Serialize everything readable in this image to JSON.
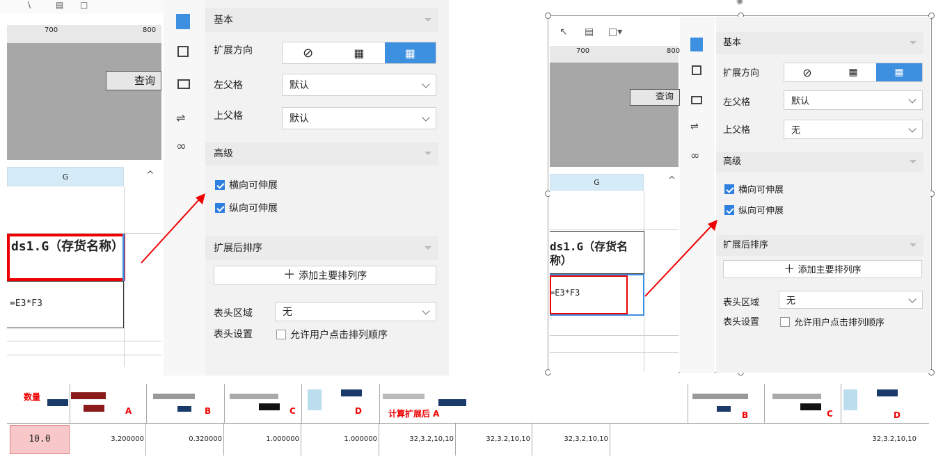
{
  "left": {
    "ruler_marks": [
      "700",
      "800"
    ],
    "query_button": "查询",
    "column_header": "G",
    "cell_dsg": "ds1.G（存货名称）",
    "cell_formula": "=E3*F3",
    "scroll_up": "^"
  },
  "left_panel": {
    "basic": "基本",
    "expand_direction": "扩展方向",
    "left_parent": "左父格",
    "left_parent_value": "默认",
    "top_parent": "上父格",
    "top_parent_value": "默认",
    "advanced": "高级",
    "horizontal_expand": "横向可伸展",
    "vertical_expand": "纵向可伸展",
    "sort_after_expand": "扩展后排序",
    "add_sort": "添加主要排列序",
    "header_area": "表头区域",
    "header_area_value": "无",
    "header_settings": "表头设置",
    "allow_click_sort": "允许用户点击排列顺序"
  },
  "right": {
    "ruler_marks": [
      "700",
      "800"
    ],
    "query_button": "查询",
    "column_header": "G",
    "cell_dsg": "ds1.G（存货名称）",
    "cell_formula": "=E3*F3"
  },
  "right_panel": {
    "basic": "基本",
    "expand_direction": "扩展方向",
    "left_parent": "左父格",
    "left_parent_value": "默认",
    "top_parent": "上父格",
    "top_parent_value": "无",
    "advanced": "高级",
    "horizontal_expand": "横向可伸展",
    "vertical_expand": "纵向可伸展",
    "sort_after_expand": "扩展后排序",
    "add_sort": "添加主要排列序",
    "header_area": "表头区域",
    "header_area_value": "无",
    "header_settings": "表头设置",
    "allow_click_sort": "允许用户点击排列顺序"
  },
  "bottom_table": {
    "header_labels": [
      "数量",
      "A",
      "B",
      "C",
      "D",
      "计算扩展后 A",
      "B",
      "C",
      "D"
    ],
    "first_cell": "10.0",
    "values": [
      "3.200000",
      "0.320000",
      "1.000000",
      "1.000000",
      "32,3.2,10,10",
      "32,3.2,10,10",
      "32,3.2,10,10",
      "32,3.2,10,10"
    ]
  },
  "colors": {
    "accent_blue": "#3d8fe0",
    "red_highlight": "#e00000",
    "panel_bg": "#f2f2f2",
    "section_header_bg": "#ebebeb",
    "column_header_bg": "#d5ebf8",
    "first_cell_bg": "#f8c8c8"
  }
}
